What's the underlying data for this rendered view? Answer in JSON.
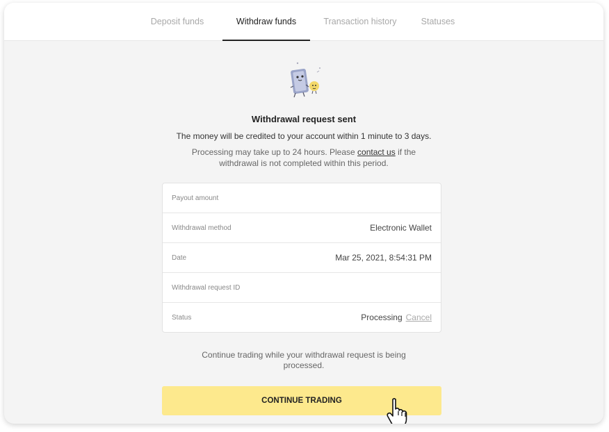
{
  "tabs": [
    {
      "label": "Deposit funds",
      "active": false
    },
    {
      "label": "Withdraw funds",
      "active": true
    },
    {
      "label": "Transaction history",
      "active": false
    },
    {
      "label": "Statuses",
      "active": false
    }
  ],
  "confirmation": {
    "title": "Withdrawal request sent",
    "subtitle": "The money will be credited to your account within 1 minute to 3 days.",
    "note_before": "Processing may take up to 24 hours. Please ",
    "note_link": "contact us",
    "note_after": " if the withdrawal is not completed within this period."
  },
  "details": [
    {
      "label": "Payout amount",
      "value": ""
    },
    {
      "label": "Withdrawal method",
      "value": "Electronic Wallet"
    },
    {
      "label": "Date",
      "value": "Mar 25, 2021, 8:54:31 PM"
    },
    {
      "label": "Withdrawal request ID",
      "value": ""
    },
    {
      "label": "Status",
      "value": "Processing",
      "action": "Cancel"
    }
  ],
  "footer": {
    "continue_text": "Continue trading while your withdrawal request is being processed.",
    "cta_label": "CONTINUE TRADING"
  },
  "icons": {
    "illustration": "wallet-mascot-icon",
    "cursor": "hand-pointer-cursor-icon"
  },
  "colors": {
    "cta_background": "#fde98d",
    "active_tab": "#222222",
    "inactive_tab": "#a8a8a8"
  }
}
